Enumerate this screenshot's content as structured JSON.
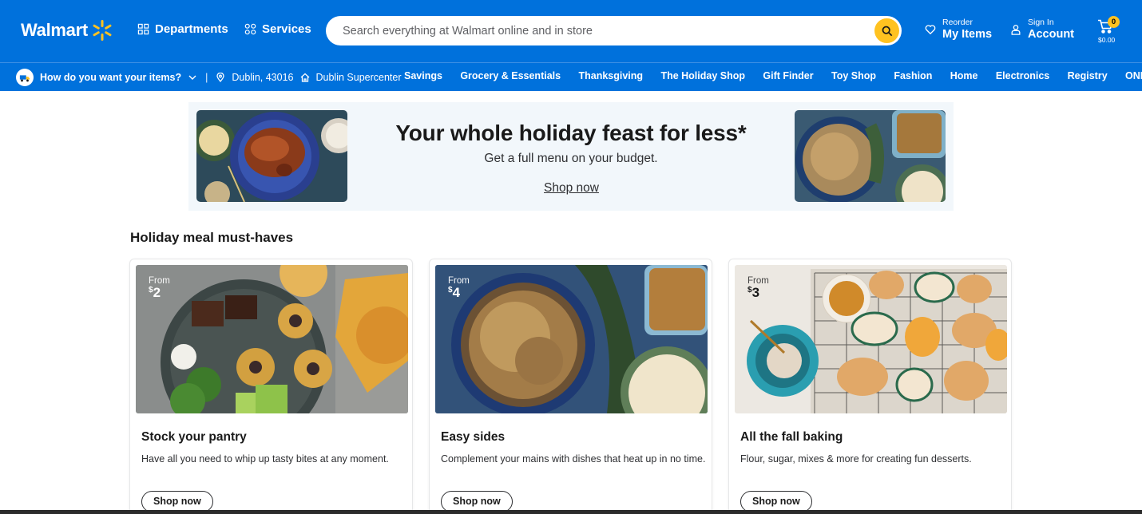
{
  "header": {
    "logo_text": "Walmart",
    "departments_label": "Departments",
    "services_label": "Services",
    "search_placeholder": "Search everything at Walmart online and in store",
    "reorder_small": "Reorder",
    "reorder_big": "My Items",
    "signin_small": "Sign In",
    "signin_big": "Account",
    "cart_count": "0",
    "cart_total": "$0.00"
  },
  "subnav": {
    "fulfillment_label": "How do you want your items?",
    "separator": "|",
    "location": "Dublin, 43016",
    "store": "Dublin Supercenter",
    "links": [
      "Savings",
      "Grocery & Essentials",
      "Thanksgiving",
      "The Holiday Shop",
      "Gift Finder",
      "Toy Shop",
      "Fashion",
      "Home",
      "Electronics",
      "Registry",
      "ONE Debit"
    ]
  },
  "hero": {
    "title": "Your whole holiday feast for less*",
    "subtitle": "Get a full menu on your budget.",
    "link": "Shop now"
  },
  "section": {
    "title": "Holiday meal must-haves",
    "cards": [
      {
        "from": "From",
        "currency": "$",
        "price": "2",
        "title": "Stock your pantry",
        "desc": "Have all you need to whip up tasty bites at any moment.",
        "button": "Shop now"
      },
      {
        "from": "From",
        "currency": "$",
        "price": "4",
        "title": "Easy sides",
        "desc": "Complement your mains with dishes that heat up in no time.",
        "button": "Shop now"
      },
      {
        "from": "From",
        "currency": "$",
        "price": "3",
        "title": "All the fall baking",
        "desc": "Flour, sugar, mixes & more for creating fun desserts.",
        "button": "Shop now"
      }
    ]
  },
  "colors": {
    "brand_blue": "#0071dc",
    "spark_yellow": "#ffc220"
  },
  "icons": [
    "spark-logo",
    "grid-icon",
    "services-icon",
    "search-icon",
    "heart-icon",
    "person-icon",
    "cart-icon",
    "truck-icon",
    "chevron-down-icon",
    "location-pin-icon",
    "store-icon"
  ]
}
